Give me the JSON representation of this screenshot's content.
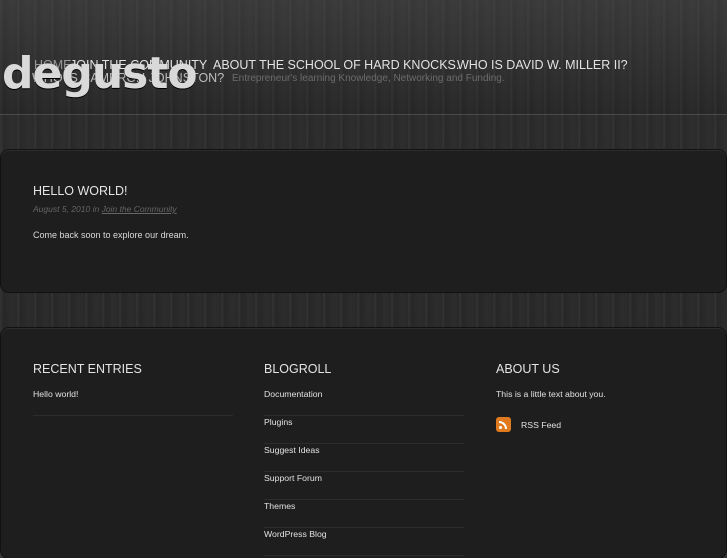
{
  "site": {
    "logo": "degusto",
    "tagline": "Entrepreneur's learning Knowledge, Networking and Funding."
  },
  "nav": {
    "items": [
      {
        "label": "HOME"
      },
      {
        "label": "JOIN THE COMMUNITY"
      },
      {
        "label": "ABOUT THE SCHOOL OF HARD KNOCKS."
      },
      {
        "label": "WHO IS DAVID W. MILLER II?"
      },
      {
        "label": "WHO IS CAMERON JOHNSTON?"
      }
    ]
  },
  "post": {
    "title": "HELLO WORLD!",
    "date": "August 5, 2010",
    "in": "in",
    "category": "Join the Community",
    "body": "Come back soon to explore our dream."
  },
  "footer": {
    "recent": {
      "title": "RECENT ENTRIES",
      "items": [
        "Hello world!"
      ]
    },
    "blogroll": {
      "title": "BLOGROLL",
      "items": [
        "Documentation",
        "Plugins",
        "Suggest Ideas",
        "Support Forum",
        "Themes",
        "WordPress Blog"
      ]
    },
    "about": {
      "title": "ABOUT US",
      "text": "This is a little text about you.",
      "rss_label": "RSS Feed"
    }
  },
  "colors": {
    "background": "#2a2a2a",
    "panel": "#1e1e1e",
    "rss_accent": "#e07a1f"
  }
}
